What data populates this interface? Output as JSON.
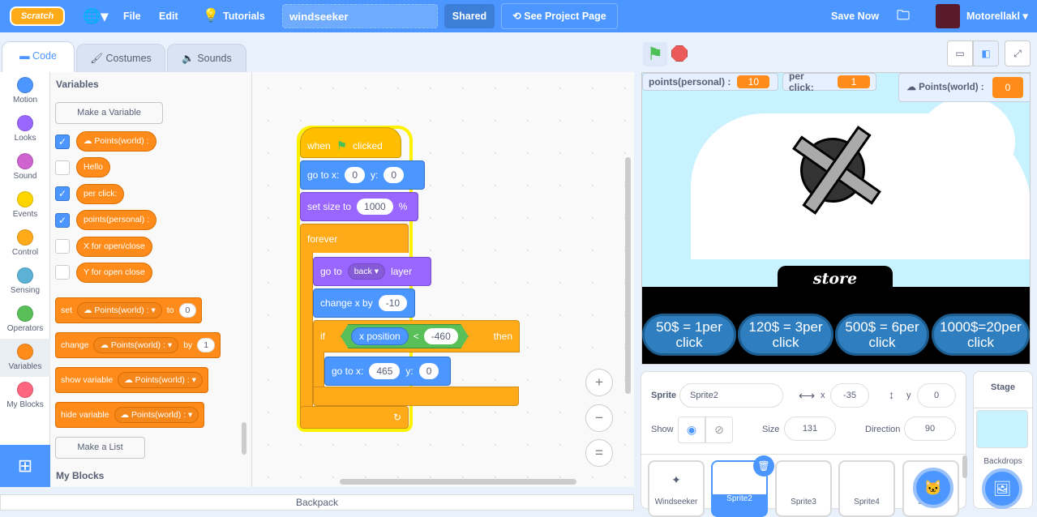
{
  "menubar": {
    "logo": "Scratch",
    "language_icon": "globe-icon",
    "file": "File",
    "edit": "Edit",
    "tutorials": "Tutorials",
    "project_title": "windseeker",
    "shared": "Shared",
    "see_project_page": "See Project Page",
    "save_now": "Save Now",
    "username": "Motorellakl",
    "accent": "#4c97ff"
  },
  "tabs": [
    {
      "label": "Code"
    },
    {
      "label": "Costumes"
    },
    {
      "label": "Sounds"
    }
  ],
  "categories": [
    {
      "label": "Motion",
      "color": "#4c97ff"
    },
    {
      "label": "Looks",
      "color": "#9966ff"
    },
    {
      "label": "Sound",
      "color": "#cf63cf"
    },
    {
      "label": "Events",
      "color": "#ffd500"
    },
    {
      "label": "Control",
      "color": "#ffab19"
    },
    {
      "label": "Sensing",
      "color": "#5cb1d6"
    },
    {
      "label": "Operators",
      "color": "#59c059"
    },
    {
      "label": "Variables",
      "color": "#ff8c1a"
    },
    {
      "label": "My Blocks",
      "color": "#ff6680"
    }
  ],
  "palette": {
    "heading": "Variables",
    "make_variable": "Make a Variable",
    "variables": [
      {
        "name": "☁ Points(world) :",
        "checked": true
      },
      {
        "name": "Hello",
        "checked": false
      },
      {
        "name": "per click:",
        "checked": true
      },
      {
        "name": "points(personal) :",
        "checked": true
      },
      {
        "name": "X for open/close",
        "checked": false
      },
      {
        "name": "Y for open close",
        "checked": false
      }
    ],
    "set_block": {
      "label": "set",
      "var": "☁ Points(world) :",
      "to": "to",
      "value": "0"
    },
    "change_block": {
      "label": "change",
      "var": "☁ Points(world) :",
      "by": "by",
      "value": "1"
    },
    "show_block": {
      "label": "show variable",
      "var": "☁ Points(world) :"
    },
    "hide_block": {
      "label": "hide variable",
      "var": "☁ Points(world) :"
    },
    "make_list": "Make a List",
    "my_blocks_heading": "My Blocks"
  },
  "script": {
    "when": "when",
    "clicked": "clicked",
    "goto": "go to x:",
    "y": "y:",
    "x0": "0",
    "y0": "0",
    "setsize": "set size to",
    "size": "1000",
    "pct": "%",
    "forever": "forever",
    "goto_layer": "go to",
    "layer_opt": "back",
    "layer": "layer",
    "changex": "change x by",
    "changex_val": "-10",
    "if": "if",
    "then": "then",
    "xpos": "x position",
    "lt": "<",
    "cmp": "-460",
    "goto2": "go to x:",
    "x2": "465",
    "y2": "0"
  },
  "zoom": {
    "in": "+",
    "out": "−",
    "reset": "="
  },
  "backpack": "Backpack",
  "stage": {
    "monitors": [
      {
        "label": "points(personal) :",
        "value": "10"
      },
      {
        "label": "per click:",
        "value": "1"
      },
      {
        "label": "☁ Points(world) :",
        "value": "0"
      }
    ],
    "store": "store",
    "buttons": [
      "50$ = 1per click",
      "120$ = 3per click",
      "500$ = 6per click",
      "1000$=20per click"
    ]
  },
  "sprite_info": {
    "sprite_label": "Sprite",
    "sprite_name": "Sprite2",
    "x_label": "x",
    "x": "-35",
    "y_label": "y",
    "y": "0",
    "show_label": "Show",
    "size_label": "Size",
    "size": "131",
    "direction_label": "Direction",
    "direction": "90"
  },
  "sprites": [
    {
      "name": "Windseeker"
    },
    {
      "name": "Sprite2",
      "selected": true
    },
    {
      "name": "Sprite3"
    },
    {
      "name": "Sprite4"
    },
    {
      "name": "Sprite5"
    }
  ],
  "stage_pane": {
    "title": "Stage",
    "backdrops": "Backdrops"
  }
}
